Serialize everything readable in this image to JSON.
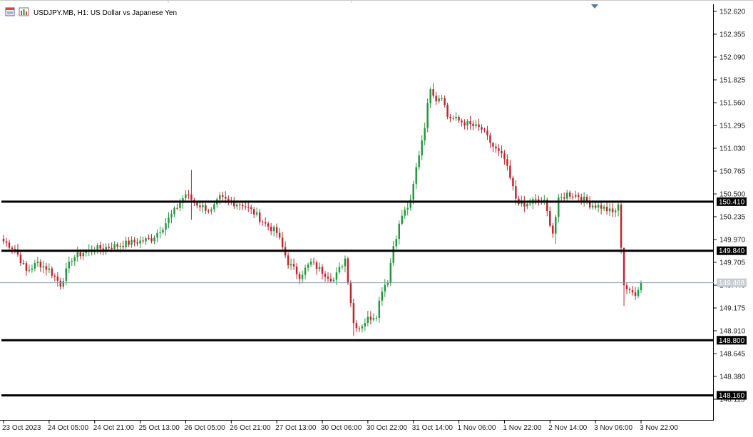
{
  "header": {
    "symbol_title": "USDJPY.MB, H1:  US Dollar vs Japanese Yen"
  },
  "colors": {
    "bull": "#1f9a3a",
    "bear": "#c2242b",
    "level_line": "#000000",
    "bid_line": "#8a9aa8",
    "bid_label_bg": "#c8cdd2",
    "axis": "#000000",
    "background": "#ffffff"
  },
  "icons": [
    "chart-window-icon",
    "bars-chart-icon",
    "scroll-marker-icon"
  ],
  "chart_data": {
    "type": "candlestick",
    "symbol": "USDJPY.MB",
    "timeframe": "H1",
    "ylim": [
      148.0,
      152.72
    ],
    "y_ticks": [
      "152.620",
      "152.355",
      "152.090",
      "151.825",
      "151.560",
      "151.295",
      "151.030",
      "150.765",
      "150.500",
      "150.235",
      "149.970",
      "149.705",
      "149.440",
      "149.175",
      "148.910",
      "148.645",
      "148.380",
      "148.115"
    ],
    "x_ticks": [
      {
        "index": 0,
        "label": "23 Oct 2023"
      },
      {
        "index": 16,
        "label": "24 Oct 05:00"
      },
      {
        "index": 32,
        "label": "24 Oct 21:00"
      },
      {
        "index": 48,
        "label": "25 Oct 13:00"
      },
      {
        "index": 64,
        "label": "26 Oct 05:00"
      },
      {
        "index": 80,
        "label": "26 Oct 21:00"
      },
      {
        "index": 96,
        "label": "27 Oct 13:00"
      },
      {
        "index": 112,
        "label": "30 Oct 06:00"
      },
      {
        "index": 128,
        "label": "30 Oct 22:00"
      },
      {
        "index": 144,
        "label": "31 Oct 14:00"
      },
      {
        "index": 160,
        "label": "1 Nov 06:00"
      },
      {
        "index": 176,
        "label": "1 Nov 22:00"
      },
      {
        "index": 192,
        "label": "2 Nov 14:00"
      },
      {
        "index": 208,
        "label": "3 Nov 06:00"
      },
      {
        "index": 224,
        "label": "3 Nov 22:00"
      }
    ],
    "candle_count": 225,
    "horizontal_levels": [
      {
        "value": 150.41,
        "label": "150.410"
      },
      {
        "value": 149.84,
        "label": "149.840"
      },
      {
        "value": 148.8,
        "label": "148.800"
      },
      {
        "value": 148.16,
        "label": "148.160"
      }
    ],
    "bid": {
      "value": 149.468,
      "label": "149.468"
    },
    "anchors": [
      [
        0,
        149.95
      ],
      [
        4,
        149.86
      ],
      [
        8,
        149.6
      ],
      [
        12,
        149.7
      ],
      [
        16,
        149.62
      ],
      [
        20,
        149.45
      ],
      [
        24,
        149.75
      ],
      [
        28,
        149.82
      ],
      [
        32,
        149.86
      ],
      [
        36,
        149.88
      ],
      [
        40,
        149.9
      ],
      [
        44,
        149.93
      ],
      [
        48,
        149.95
      ],
      [
        52,
        149.98
      ],
      [
        56,
        150.12
      ],
      [
        60,
        150.3
      ],
      [
        64,
        150.5
      ],
      [
        67,
        150.4
      ],
      [
        70,
        150.35
      ],
      [
        73,
        150.3
      ],
      [
        76,
        150.45
      ],
      [
        80,
        150.4
      ],
      [
        84,
        150.38
      ],
      [
        88,
        150.28
      ],
      [
        92,
        150.15
      ],
      [
        96,
        150.05
      ],
      [
        100,
        149.7
      ],
      [
        104,
        149.55
      ],
      [
        108,
        149.7
      ],
      [
        112,
        149.6
      ],
      [
        116,
        149.5
      ],
      [
        120,
        149.75
      ],
      [
        123,
        149.0
      ],
      [
        125,
        148.95
      ],
      [
        128,
        149.05
      ],
      [
        131,
        149.1
      ],
      [
        133,
        149.4
      ],
      [
        135,
        149.5
      ],
      [
        137,
        149.9
      ],
      [
        140,
        150.25
      ],
      [
        143,
        150.4
      ],
      [
        145,
        150.8
      ],
      [
        148,
        151.3
      ],
      [
        150,
        151.75
      ],
      [
        152,
        151.6
      ],
      [
        154,
        151.65
      ],
      [
        156,
        151.4
      ],
      [
        160,
        151.35
      ],
      [
        164,
        151.3
      ],
      [
        168,
        151.25
      ],
      [
        172,
        151.05
      ],
      [
        176,
        150.9
      ],
      [
        180,
        150.45
      ],
      [
        183,
        150.35
      ],
      [
        186,
        150.42
      ],
      [
        190,
        150.4
      ],
      [
        193,
        150.05
      ],
      [
        195,
        150.42
      ],
      [
        198,
        150.5
      ],
      [
        202,
        150.48
      ],
      [
        206,
        150.38
      ],
      [
        210,
        150.35
      ],
      [
        214,
        150.28
      ],
      [
        216,
        150.35
      ],
      [
        218,
        149.45
      ],
      [
        220,
        149.35
      ],
      [
        222,
        149.35
      ],
      [
        224,
        149.468
      ]
    ],
    "spike_candles": [
      {
        "index": 66,
        "high": 150.78,
        "low": 150.2
      },
      {
        "index": 123,
        "low": 148.85
      },
      {
        "index": 146,
        "high": 151.0
      },
      {
        "index": 172,
        "high": 151.1
      },
      {
        "index": 194,
        "low": 149.92
      },
      {
        "index": 218,
        "high": 149.75,
        "low": 149.2
      }
    ]
  }
}
